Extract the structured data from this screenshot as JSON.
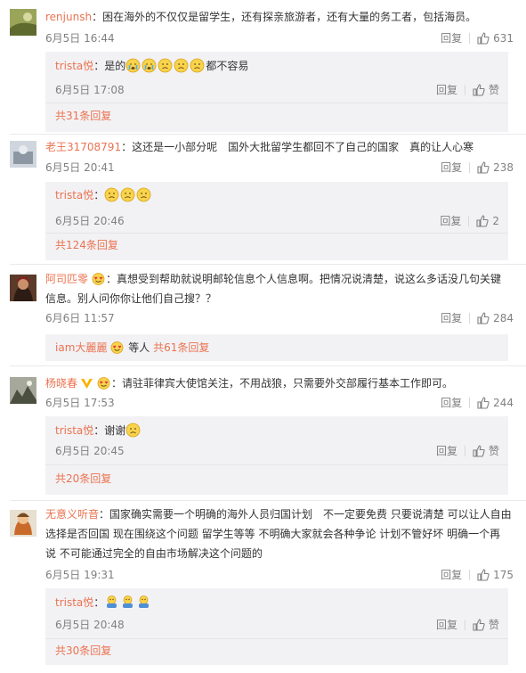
{
  "comments": [
    {
      "user": "renjunsh",
      "text": "：困在海外的不仅仅是留学生，还有探亲旅游者，还有大量的务工者，包括海员。",
      "time": "6月5日 16:44",
      "reply_label": "回复",
      "likes": "631",
      "replies": [
        {
          "user": "trista悦",
          "text_before": "：是的",
          "text_after": "都不容易",
          "time": "6月5日 17:08",
          "reply_label": "回复",
          "likes": "赞"
        }
      ],
      "more": "共31条回复"
    },
    {
      "user": "老王31708791",
      "text": "：这还是一小部分呢　国外大批留学生都回不了自己的国家　真的让人心寒",
      "time": "6月5日 20:41",
      "reply_label": "回复",
      "likes": "238",
      "replies": [
        {
          "user": "trista悦",
          "text_before": "：",
          "text_after": "",
          "time": "6月5日 20:46",
          "reply_label": "回复",
          "likes": "2"
        }
      ],
      "more": "共124条回复"
    },
    {
      "user": "阿司匹零",
      "text_line1": "：真想受到帮助就说明邮轮信息个人信息啊。把情况说清楚，说这么多话没几句关键",
      "text_line2": "信息。别人问你你让他们自己搜？？",
      "time": "6月6日 11:57",
      "reply_label": "回复",
      "likes": "284",
      "reply_user": "iam大麗麗",
      "reply_mid": "等人",
      "more": "共61条回复"
    },
    {
      "user": "杨晓春",
      "text": "：请驻菲律宾大使馆关注，不用战狼，只需要外交部履行基本工作即可。",
      "time": "6月5日 17:53",
      "reply_label": "回复",
      "likes": "244",
      "replies": [
        {
          "user": "trista悦",
          "text_before": "：谢谢",
          "text_after": "",
          "time": "6月5日 20:45",
          "reply_label": "回复",
          "likes": "赞"
        }
      ],
      "more": "共20条回复"
    },
    {
      "user": "无意义听音",
      "text_line1": "：国家确实需要一个明确的海外人员归国计划　不一定要免费 只要说清楚 可以让人自由",
      "text_line2": "选择是否回国 现在围绕这个问题 留学生等等 不明确大家就会各种争论 计划不管好坏 明确一个再",
      "text_line3": "说 不可能通过完全的自由市场解决这个问题的",
      "time": "6月5日 19:31",
      "reply_label": "回复",
      "likes": "175",
      "replies": [
        {
          "user": "trista悦",
          "text_before": "：",
          "text_after": "",
          "time": "6月5日 20:48",
          "reply_label": "回复",
          "likes": "赞"
        }
      ],
      "more": "共30条回复"
    }
  ]
}
